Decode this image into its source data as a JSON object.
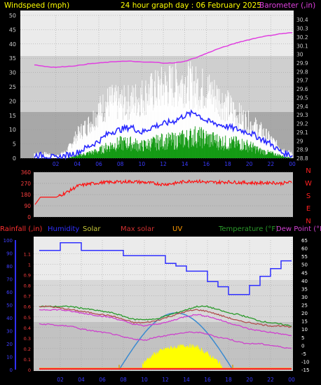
{
  "header": {
    "left_title": "Windspeed (mph)",
    "center_title": "24 hour graph day : 06 February 2025",
    "right_title": "Barometer (,in)"
  },
  "colors": {
    "wind_gust": "#ffffff",
    "wind_avg": "#2a2aff",
    "wind_green": "#119911",
    "barometer": "#e040e0",
    "wind_dir": "#ff1010",
    "rain": "#ff2020",
    "humidity": "#3030ff",
    "solar": "#ffff00",
    "max_solar": "#d03030",
    "uv": "#3a8ad0",
    "temperature": "#2a9a2a",
    "dew_point": "#d040d0",
    "header_yellow": "#ffff00",
    "axis_text": "#cccccc"
  },
  "chart_data": [
    {
      "type": "line",
      "name": "wind_and_barometer",
      "title": "24 hour graph day : 06 February 2025",
      "ylabel_left": "Windspeed (mph)",
      "ylabel_right": "Barometer (,in)",
      "x_ticks": [
        "00",
        "02",
        "04",
        "06",
        "08",
        "10",
        "12",
        "14",
        "16",
        "18",
        "20",
        "22",
        "00"
      ],
      "y_left_ticks": [
        "0",
        "5",
        "10",
        "15",
        "20",
        "25",
        "30",
        "35",
        "40",
        "45",
        "50"
      ],
      "y_right_ticks": [
        "28.8",
        "28.9",
        "29",
        "29.1",
        "29.2",
        "29.3",
        "29.4",
        "29.5",
        "29.6",
        "29.7",
        "29.8",
        "29.9",
        "30",
        "30.1",
        "30.2",
        "30.3",
        "30.4"
      ],
      "ylim_left": [
        0,
        50
      ],
      "ylim_right": [
        28.8,
        30.45
      ],
      "x_hours": [
        0,
        1,
        2,
        3,
        4,
        5,
        6,
        7,
        8,
        9,
        10,
        11,
        12,
        13,
        14,
        15,
        16,
        17,
        18,
        19,
        20,
        21,
        22,
        23,
        24
      ],
      "series": [
        {
          "name": "Barometer",
          "values": [
            29.88,
            29.86,
            29.85,
            29.86,
            29.87,
            29.89,
            29.9,
            29.91,
            29.92,
            29.92,
            29.91,
            29.91,
            29.9,
            29.9,
            29.92,
            29.96,
            30.01,
            30.06,
            30.1,
            30.14,
            30.17,
            30.2,
            30.22,
            30.24,
            30.25
          ]
        },
        {
          "name": "Gust",
          "values": [
            2,
            2,
            1,
            3,
            10,
            14,
            20,
            24,
            23,
            24,
            26,
            28,
            30,
            31,
            32,
            30,
            29,
            26,
            22,
            18,
            15,
            12,
            8,
            4,
            2
          ]
        },
        {
          "name": "Average",
          "values": [
            1,
            1,
            0,
            1,
            2,
            4,
            6,
            9,
            10,
            11,
            9,
            11,
            12,
            13,
            15,
            16,
            13,
            12,
            11,
            10,
            9,
            7,
            5,
            2,
            1
          ]
        },
        {
          "name": "Lull",
          "values": [
            0,
            0,
            0,
            0,
            1,
            2,
            3,
            5,
            6,
            6,
            5,
            6,
            7,
            7,
            8,
            9,
            8,
            7,
            6,
            6,
            5,
            3,
            2,
            1,
            0
          ]
        }
      ]
    },
    {
      "type": "line",
      "name": "wind_direction",
      "y_ticks": [
        "0",
        "90",
        "180",
        "270",
        "360"
      ],
      "y_right_labels": [
        "N",
        "W",
        "S",
        "E",
        "N"
      ],
      "ylim": [
        0,
        360
      ],
      "x_hours": [
        0,
        0.5,
        1,
        1.5,
        2,
        3,
        4,
        5,
        6,
        7,
        8,
        9,
        10,
        11,
        12,
        13,
        14,
        15,
        16,
        17,
        18,
        19,
        20,
        21,
        22,
        23,
        24
      ],
      "series": [
        {
          "name": "Direction",
          "values": [
            100,
            160,
            160,
            160,
            160,
            200,
            250,
            265,
            275,
            280,
            282,
            285,
            280,
            272,
            262,
            270,
            285,
            290,
            280,
            278,
            282,
            278,
            275,
            272,
            278,
            270,
            280
          ]
        }
      ]
    },
    {
      "type": "line",
      "name": "rain_humidity_temp",
      "legend": [
        "Rainfall (,in)",
        "Humidity",
        "Solar",
        "Max solar",
        "UV",
        "Temperature (°F)",
        "Dew Point (°F)"
      ],
      "x_ticks": [
        "02",
        "04",
        "06",
        "08",
        "10",
        "12",
        "14",
        "16",
        "18",
        "20",
        "22",
        "00"
      ],
      "y_left_ticks": [
        "0",
        "10",
        "20",
        "30",
        "40",
        "50",
        "60",
        "70",
        "80",
        "90",
        "100"
      ],
      "y_rain_ticks": [
        "0",
        "0.05",
        "0.1",
        "0.15",
        "0.2",
        "0.25",
        "0.3",
        "0.35",
        "0.4",
        "0.45",
        "0.5",
        "0.55",
        "0.6",
        "0.65",
        "0.7",
        "0.75",
        "0.8",
        "0.85",
        "0.9",
        "0.95",
        "1",
        "1.05",
        "1.1",
        "1.15"
      ],
      "y_right_ticks": [
        "-15",
        "-10",
        "-5",
        "0",
        "5",
        "10",
        "15",
        "20",
        "25",
        "30",
        "35",
        "40",
        "45",
        "50",
        "55",
        "60",
        "65"
      ],
      "ylim_humidity": [
        0,
        100
      ],
      "ylim_temp": [
        -15,
        65
      ],
      "x_hours": [
        0,
        1,
        2,
        3,
        4,
        5,
        6,
        7,
        8,
        9,
        10,
        11,
        12,
        13,
        14,
        15,
        16,
        17,
        18,
        19,
        20,
        21,
        22,
        23,
        24
      ],
      "series": [
        {
          "name": "Humidity",
          "values": [
            92,
            92,
            98,
            98,
            92,
            92,
            92,
            92,
            88,
            88,
            88,
            88,
            82,
            80,
            76,
            76,
            68,
            64,
            58,
            58,
            65,
            72,
            78,
            84,
            84
          ]
        },
        {
          "name": "Temperature",
          "values": [
            24,
            24,
            24,
            24,
            23,
            22,
            21,
            20,
            18,
            16,
            16,
            16,
            18,
            20,
            22,
            24,
            24,
            22,
            20,
            19,
            17,
            15,
            14,
            13,
            12
          ]
        },
        {
          "name": "Dew Point",
          "values": [
            24,
            24,
            23,
            22,
            21,
            20,
            19,
            18,
            16,
            14,
            14,
            15,
            17,
            19,
            21,
            22,
            21,
            19,
            17,
            15,
            14,
            13,
            12,
            12,
            11
          ]
        },
        {
          "name": "Temperature 2",
          "values": [
            22,
            22,
            22,
            21,
            20,
            19,
            18,
            17,
            15,
            13,
            12,
            13,
            14,
            16,
            18,
            19,
            18,
            16,
            14,
            12,
            10,
            9,
            8,
            7,
            6
          ]
        },
        {
          "name": "Wind chill",
          "values": [
            13,
            13,
            12,
            12,
            10,
            9,
            8,
            7,
            5,
            4,
            3,
            5,
            6,
            7,
            8,
            8,
            7,
            5,
            4,
            2,
            1,
            1,
            0,
            -1,
            -2
          ]
        },
        {
          "name": "UV",
          "values": [
            0,
            0,
            0,
            0,
            0,
            0,
            0,
            0,
            0,
            0,
            0.2,
            0.45,
            0.65,
            0.75,
            0.8,
            0.72,
            0.5,
            0.25,
            0,
            0,
            0,
            0,
            0,
            0,
            0
          ]
        },
        {
          "name": "Solar",
          "values": [
            0,
            0,
            0,
            0,
            0,
            0,
            0,
            0,
            0,
            0,
            5,
            10,
            13,
            14,
            15,
            14,
            10,
            5,
            0,
            0,
            0,
            0,
            0,
            0,
            0
          ]
        },
        {
          "name": "Rainfall",
          "values": [
            0,
            0,
            0,
            0,
            0,
            0,
            0,
            0,
            0,
            0,
            0,
            0,
            0,
            0,
            0,
            0,
            0,
            0,
            0,
            0,
            0,
            0,
            0,
            0,
            0
          ]
        }
      ]
    }
  ]
}
